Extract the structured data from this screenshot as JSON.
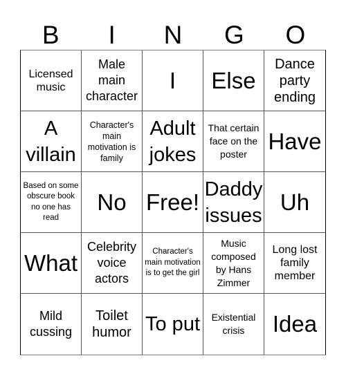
{
  "header": {
    "letters": [
      "B",
      "I",
      "N",
      "G",
      "O"
    ]
  },
  "cells": [
    {
      "text": "Licensed music",
      "size": "s-s"
    },
    {
      "text": "Male main character",
      "size": "s-ms"
    },
    {
      "text": "I",
      "size": "s-xl"
    },
    {
      "text": "Else",
      "size": "s-xl"
    },
    {
      "text": "Dance party ending",
      "size": "s-m"
    },
    {
      "text": "A villain",
      "size": "s-l"
    },
    {
      "text": "Character's main motivation is family",
      "size": "s-xxs"
    },
    {
      "text": "Adult jokes",
      "size": "s-l"
    },
    {
      "text": "That certain face on the poster",
      "size": "s-xs"
    },
    {
      "text": "Have",
      "size": "s-xl"
    },
    {
      "text": "Based on some obscure book no one has read",
      "size": "s-tiny"
    },
    {
      "text": "No",
      "size": "s-xl"
    },
    {
      "text": "Free!",
      "size": "s-xl"
    },
    {
      "text": "Daddy issues",
      "size": "s-l"
    },
    {
      "text": "Uh",
      "size": "s-xl"
    },
    {
      "text": "What",
      "size": "s-xl"
    },
    {
      "text": "Celebrity voice actors",
      "size": "s-ms"
    },
    {
      "text": "Character's main motivation is to get the girl",
      "size": "s-tiny"
    },
    {
      "text": "Music composed by Hans Zimmer",
      "size": "s-xs"
    },
    {
      "text": "Long lost family member",
      "size": "s-s"
    },
    {
      "text": "Mild cussing",
      "size": "s-ms"
    },
    {
      "text": "Toilet humor",
      "size": "s-m"
    },
    {
      "text": "To put",
      "size": "s-l"
    },
    {
      "text": "Existential crisis",
      "size": "s-xs"
    },
    {
      "text": "Idea",
      "size": "s-xl"
    }
  ]
}
